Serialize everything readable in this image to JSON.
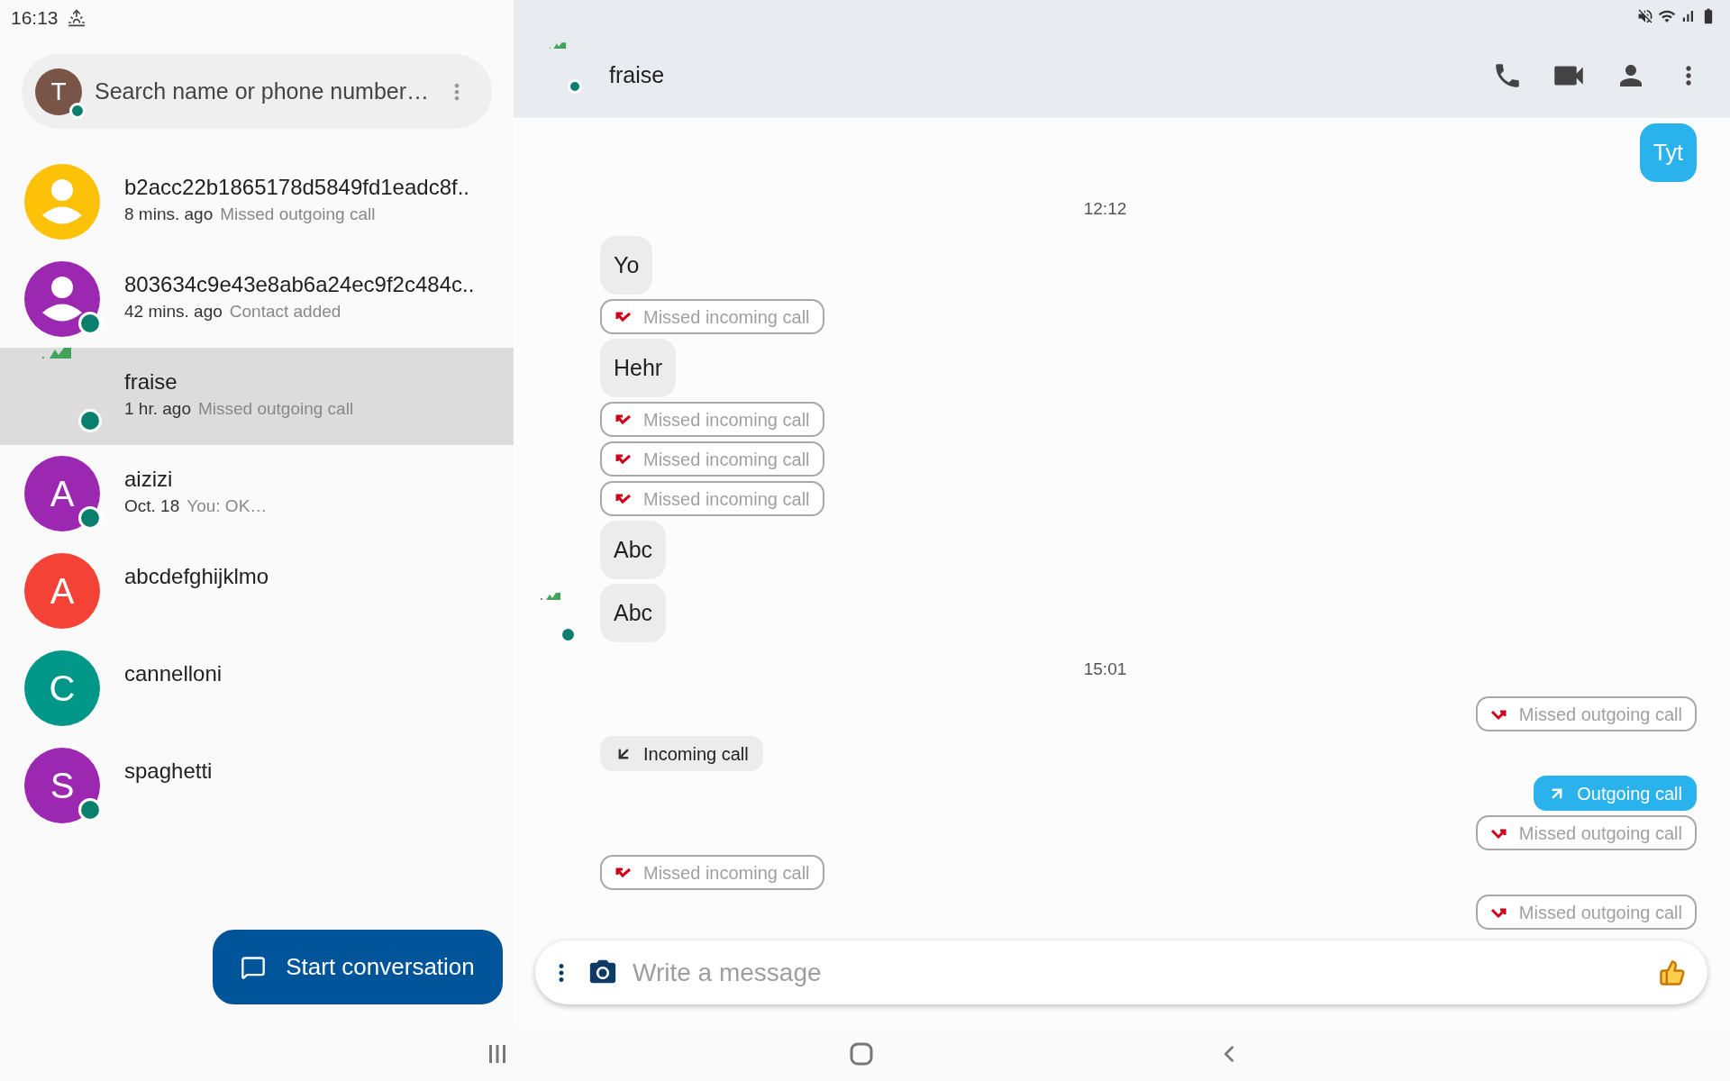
{
  "status_bar": {
    "time": "16:13"
  },
  "search": {
    "avatar_letter": "T",
    "online": true,
    "placeholder": "Search name or phone number…"
  },
  "conversations": [
    {
      "avatar": {
        "kind": "person",
        "color": "#fdc107"
      },
      "online": false,
      "name": "b2acc22b1865178d5849fd1eadc8f..",
      "time": "8 mins. ago",
      "preview": "Missed outgoing call",
      "selected": false
    },
    {
      "avatar": {
        "kind": "person",
        "color": "#9c27b0"
      },
      "online": true,
      "name": "803634c9e43e8ab6a24ec9f2c484c..",
      "time": "42 mins. ago",
      "preview": "Contact added",
      "selected": false
    },
    {
      "avatar": {
        "kind": "broken_image"
      },
      "online": true,
      "name": "fraise",
      "time": "1 hr. ago",
      "preview": "Missed outgoing call",
      "selected": true
    },
    {
      "avatar": {
        "kind": "letter",
        "letter": "A",
        "color": "#9c27b0"
      },
      "online": true,
      "name": "aizizi",
      "time": "Oct. 18",
      "preview": "You: OK…",
      "selected": false
    },
    {
      "avatar": {
        "kind": "letter",
        "letter": "A",
        "color": "#f44336"
      },
      "online": false,
      "name": "abcdefghijklmo",
      "selected": false
    },
    {
      "avatar": {
        "kind": "letter",
        "letter": "C",
        "color": "#009688"
      },
      "online": false,
      "name": "cannelloni",
      "selected": false
    },
    {
      "avatar": {
        "kind": "letter",
        "letter": "S",
        "color": "#9c27b0"
      },
      "online": true,
      "name": "spaghetti",
      "selected": false
    }
  ],
  "start_button": {
    "label": "Start conversation"
  },
  "chat": {
    "title": "fraise",
    "online": true,
    "messages": [
      {
        "kind": "sent",
        "text": "Tyt",
        "avatar": false
      },
      {
        "kind": "time",
        "text": "12:12"
      },
      {
        "kind": "received",
        "text": "Yo",
        "avatar": false
      },
      {
        "kind": "missed_incoming",
        "text": "Missed incoming call"
      },
      {
        "kind": "received",
        "text": "Hehr",
        "avatar": false
      },
      {
        "kind": "missed_incoming",
        "text": "Missed incoming call"
      },
      {
        "kind": "missed_incoming",
        "text": "Missed incoming call"
      },
      {
        "kind": "missed_incoming",
        "text": "Missed incoming call"
      },
      {
        "kind": "received",
        "text": "Abc",
        "avatar": false
      },
      {
        "kind": "received",
        "text": "Abc",
        "avatar": true
      },
      {
        "kind": "time",
        "text": "15:01"
      },
      {
        "kind": "missed_outgoing",
        "text": "Missed outgoing call"
      },
      {
        "kind": "incoming",
        "text": "Incoming call"
      },
      {
        "kind": "outgoing",
        "text": "Outgoing call"
      },
      {
        "kind": "missed_outgoing",
        "text": "Missed outgoing call"
      },
      {
        "kind": "missed_incoming",
        "text": "Missed incoming call"
      },
      {
        "kind": "missed_outgoing",
        "text": "Missed outgoing call"
      }
    ],
    "compose": {
      "placeholder": "Write a message"
    }
  }
}
